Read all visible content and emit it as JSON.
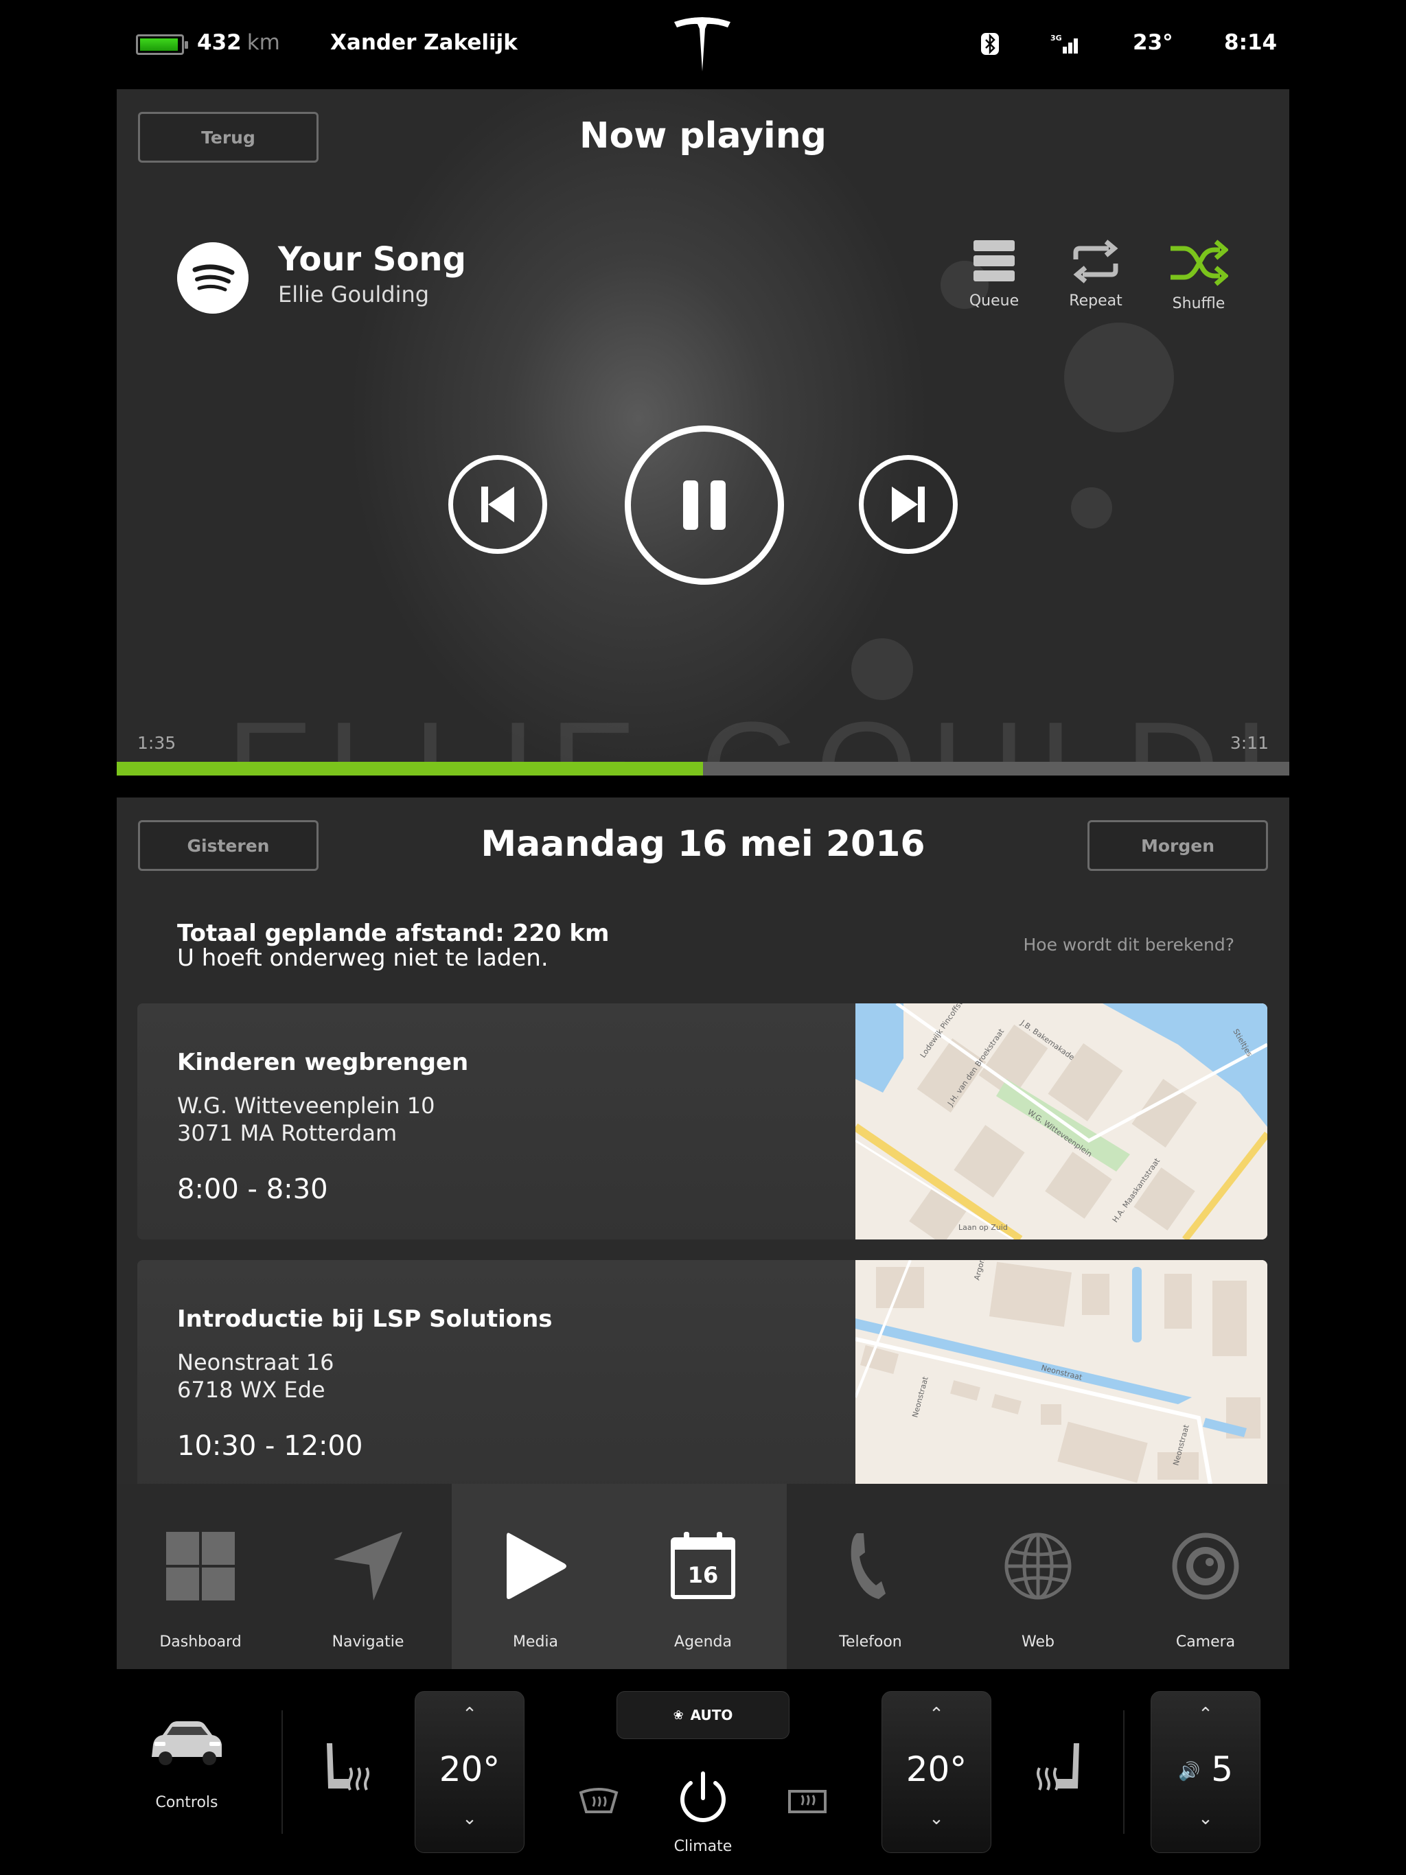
{
  "status": {
    "battery_level": 0.95,
    "battery_color": "#2fc210",
    "range_value": "432",
    "range_unit": "km",
    "user": "Xander Zakelijk",
    "logo_icon": "tesla-logo-icon",
    "bluetooth_icon": "bluetooth-icon",
    "network_label": "3G",
    "temperature": "23°",
    "time": "8:14"
  },
  "player": {
    "back_label": "Terug",
    "title": "Now playing",
    "source_icon": "spotify-icon",
    "song": "Your Song",
    "artist": "Ellie Goulding",
    "background_text": "ELLIE GOULDING",
    "modes": [
      {
        "label": "Queue",
        "icon": "queue-icon",
        "active": false
      },
      {
        "label": "Repeat",
        "icon": "repeat-icon",
        "active": false
      },
      {
        "label": "Shuffle",
        "icon": "shuffle-icon",
        "active": true
      }
    ],
    "accent": "#7bc41c",
    "elapsed": "1:35",
    "duration": "3:11",
    "progress": 0.5
  },
  "agenda": {
    "prev_label": "Gisteren",
    "next_label": "Morgen",
    "date": "Maandag 16 mei 2016",
    "summary_title": "Totaal geplande afstand: 220 km",
    "summary_note": "U hoeft onderweg niet te laden.",
    "help_link": "Hoe wordt dit berekend?",
    "events": [
      {
        "title": "Kinderen wegbrengen",
        "address1": "W.G. Witteveenplein 10",
        "address2": "3071 MA Rotterdam",
        "time": "8:00 - 8:30",
        "map_labels": [
          "J.B. Bakemakade",
          "Lodewijk Pincoffsweg",
          "J.H. van den Broekstraat",
          "W.G. Witteveenplein",
          "H.A. Maaskantstraat",
          "Stieltjes",
          "Laan op Zuid"
        ]
      },
      {
        "title": "Introductie bij LSP Solutions",
        "address1": "Neonstraat 16",
        "address2": "6718 WX Ede",
        "time": "10:30 - 12:00",
        "map_labels": [
          "Neonstraat",
          "Neonstraat",
          "Neonstraat",
          "Argon"
        ]
      }
    ]
  },
  "dock": {
    "items": [
      {
        "label": "Dashboard",
        "icon": "dashboard-grid-icon"
      },
      {
        "label": "Navigatie",
        "icon": "navigation-arrow-icon"
      },
      {
        "label": "Media",
        "icon": "play-icon"
      },
      {
        "label": "Agenda",
        "icon": "calendar-icon",
        "day": "16"
      },
      {
        "label": "Telefoon",
        "icon": "phone-icon"
      },
      {
        "label": "Web",
        "icon": "globe-icon"
      },
      {
        "label": "Camera",
        "icon": "camera-icon"
      }
    ],
    "selected": [
      "Media",
      "Agenda"
    ]
  },
  "climate": {
    "controls_label": "Controls",
    "left_temp": "20°",
    "right_temp": "20°",
    "auto_label": "AUTO",
    "climate_label": "Climate",
    "volume": "5"
  }
}
